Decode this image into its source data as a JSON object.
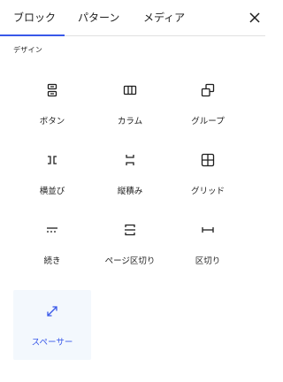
{
  "tabs": [
    {
      "label": "ブロック",
      "active": true
    },
    {
      "label": "パターン",
      "active": false
    },
    {
      "label": "メディア",
      "active": false
    }
  ],
  "section": {
    "title": "デザイン"
  },
  "blocks": [
    {
      "label": "ボタン",
      "icon": "buttons-icon"
    },
    {
      "label": "カラム",
      "icon": "columns-icon"
    },
    {
      "label": "グループ",
      "icon": "group-icon"
    },
    {
      "label": "横並び",
      "icon": "row-icon"
    },
    {
      "label": "縦積み",
      "icon": "stack-icon"
    },
    {
      "label": "グリッド",
      "icon": "grid-icon"
    },
    {
      "label": "続き",
      "icon": "more-icon"
    },
    {
      "label": "ページ区切り",
      "icon": "page-break-icon"
    },
    {
      "label": "区切り",
      "icon": "separator-icon"
    },
    {
      "label": "スペーサー",
      "icon": "spacer-icon",
      "selected": true
    }
  ],
  "colors": {
    "accent": "#3858e9",
    "selected_bg": "#f3f8fd",
    "text": "#1e1e1e"
  }
}
